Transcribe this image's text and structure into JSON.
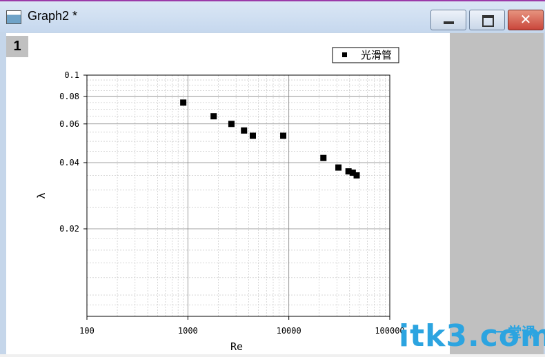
{
  "window": {
    "title": "Graph2 *",
    "layer_number": "1",
    "close_glyph": "✕"
  },
  "icons": {
    "app": "origin-graph-icon",
    "minimize": "minimize-icon",
    "maximize": "maximize-icon",
    "close": "close-icon"
  },
  "chart_data": {
    "type": "scatter",
    "xlabel": "Re",
    "ylabel": "λ",
    "x_scale": "log",
    "y_scale": "log",
    "xlim": [
      100,
      100000
    ],
    "ylim": [
      0.008,
      0.1
    ],
    "x_ticks": [
      100,
      1000,
      10000,
      100000
    ],
    "x_tick_labels": [
      "100",
      "1000",
      "10000",
      "100000"
    ],
    "y_ticks": [
      0.02,
      0.04,
      0.06,
      0.08,
      0.1
    ],
    "y_tick_labels": [
      "0.02",
      "0.04",
      "0.06",
      "0.08",
      "0.1"
    ],
    "grid": true,
    "legend_position": "top-right",
    "marker_color": "#000000",
    "series": [
      {
        "name": "光滑管",
        "marker": "square",
        "points": [
          {
            "x": 900,
            "y": 0.075
          },
          {
            "x": 1800,
            "y": 0.065
          },
          {
            "x": 2700,
            "y": 0.06
          },
          {
            "x": 3600,
            "y": 0.056
          },
          {
            "x": 4400,
            "y": 0.053
          },
          {
            "x": 8800,
            "y": 0.053
          },
          {
            "x": 22000,
            "y": 0.042
          },
          {
            "x": 31000,
            "y": 0.038
          },
          {
            "x": 39000,
            "y": 0.0365
          },
          {
            "x": 43000,
            "y": 0.036
          },
          {
            "x": 47000,
            "y": 0.035
          }
        ]
      }
    ]
  },
  "watermark": {
    "main": "itk3.com",
    "cn": "一堂课"
  }
}
